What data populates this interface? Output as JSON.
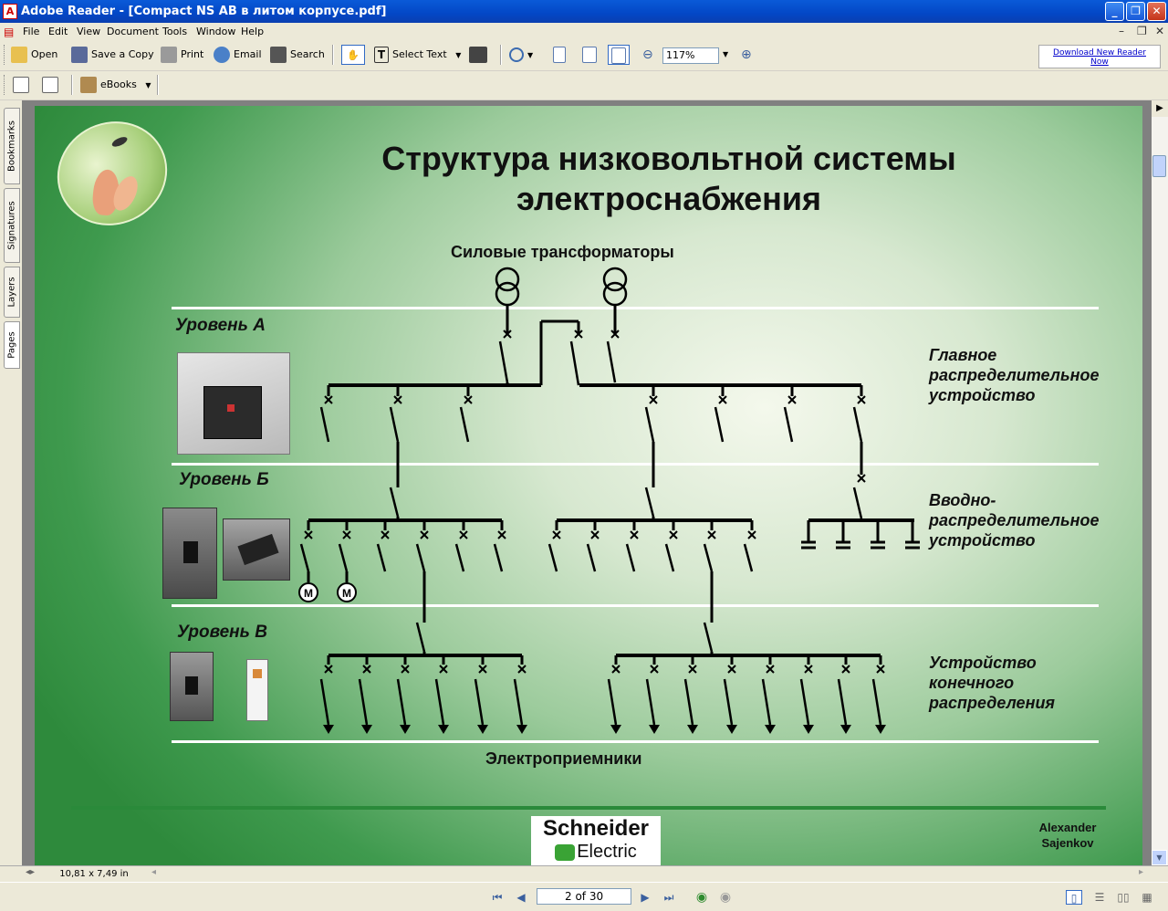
{
  "window": {
    "app_icon": "acrobat-icon",
    "title": "Adobe Reader - [Compact NS AB в литом корпусе.pdf]"
  },
  "menu": [
    "File",
    "Edit",
    "View",
    "Document",
    "Tools",
    "Window",
    "Help"
  ],
  "toolbar": {
    "open": "Open",
    "save_copy": "Save a Copy",
    "print": "Print",
    "email": "Email",
    "search": "Search",
    "select_text": "Select Text",
    "zoom": "117%",
    "ebooks": "eBooks",
    "download_line1": "Download New Reader",
    "download_line2": "Now"
  },
  "nav_tabs": [
    "Bookmarks",
    "Signatures",
    "Layers",
    "Pages"
  ],
  "slide": {
    "title_line1": "Структура низковольтной системы",
    "title_line2": "электроснабжения",
    "transformers_label": "Силовые трансформаторы",
    "level_a": "Уровень А",
    "level_b": "Уровень Б",
    "level_c": "Уровень В",
    "desc_a": [
      "Главное",
      "распределительное",
      "устройство"
    ],
    "desc_b": [
      "Вводно-",
      "распределительное",
      "устройство"
    ],
    "desc_c": [
      "Устройство",
      "конечного",
      "распределения"
    ],
    "consumers_label": "Электроприемники",
    "motor_symbol": "M",
    "logo_line1": "Schneider",
    "logo_line2": "Electric",
    "author_line1": "Alexander",
    "author_line2": "Sajenkov"
  },
  "status": {
    "page_size": "10,81 x 7,49 in",
    "page_indicator": "2 of 30"
  }
}
